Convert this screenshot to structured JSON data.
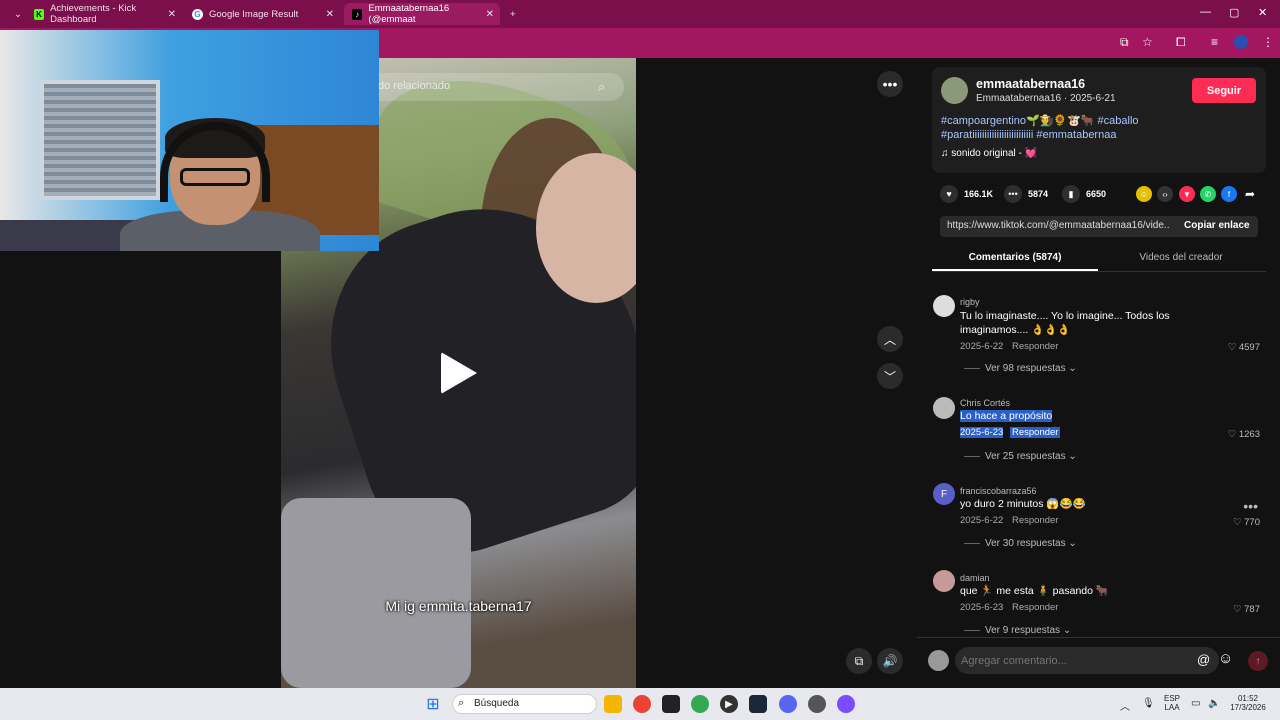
{
  "browser": {
    "tabs": [
      {
        "title": "Achievements - Kick Dashboard",
        "favicon": "K"
      },
      {
        "title": "Google Image Result",
        "favicon": "G"
      },
      {
        "title": "Emmaatabernaa16 (@emmaat",
        "favicon": "♪"
      }
    ],
    "new_tab": "+",
    "menu_chevron": "⌄"
  },
  "video": {
    "search_placeholder": "do relacionado",
    "caption": "Mi ig emmita.taberna17"
  },
  "author": {
    "username": "emmaatabernaa16",
    "nickname_date": "Emmaatabernaa16 · 2025-6-21",
    "follow_label": "Seguir",
    "hashtags_line1": "#campoargentino🌱🧑‍🌾🌻🐮🐂 #caballo",
    "hashtags_line2": "#paratiiiiiiiiiiiiiiiiiiiiiiiii #emmatabernaa",
    "music": "♫  sonido original - 💓"
  },
  "stats": {
    "likes": "166.1K",
    "comments": "5874",
    "saves": "6650"
  },
  "link": {
    "url": "https://www.tiktok.com/@emmaatabernaa16/vide...",
    "copy_label": "Copiar enlace"
  },
  "tabs": {
    "comments": "Comentarios (5874)",
    "videos": "Videos del creador"
  },
  "comments": [
    {
      "name": "rigby",
      "text": "Tu lo imaginaste.... Yo lo imagine... Todos los imaginamos.... 👌👌👌",
      "date": "2025-6-22",
      "reply": "Responder",
      "likes": "4597",
      "view_replies": "Ver 98 respuestas ⌄"
    },
    {
      "name": "Chris Cortés",
      "text": "Lo hace a propósito",
      "date": "2025-6-23",
      "reply": "Responder",
      "likes": "1263",
      "view_replies": "Ver 25 respuestas ⌄"
    },
    {
      "name": "franciscobarraza56",
      "avatar_letter": "F",
      "text": "yo duro 2 minutos 😱😂😂",
      "date": "2025-6-22",
      "reply": "Responder",
      "likes": "770",
      "view_replies": "Ver 30 respuestas ⌄"
    },
    {
      "name": "damian",
      "text": "que 🏃 me esta 🧍 pasando 🐂",
      "date": "2025-6-23",
      "reply": "Responder",
      "likes": "787",
      "view_replies": "Ver 9 respuestas ⌄"
    }
  ],
  "comment_input": {
    "placeholder": "Agregar comentario...",
    "mention": "@",
    "emoji": "☺"
  },
  "taskbar": {
    "search_label": "Búsqueda",
    "lang_top": "ESP",
    "lang_bottom": "LAA",
    "time": "01:52",
    "date": "17/3/2026"
  },
  "colors": {
    "tabbar": "#7b0f4c",
    "toolbar": "#a2175f",
    "follow": "#fe2c55",
    "hashtag": "#a6c8ff",
    "highlight": "#2a5fc9"
  }
}
